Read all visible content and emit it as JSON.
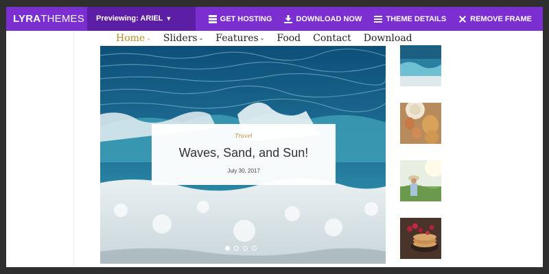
{
  "topbar": {
    "brand_bold": "LYRA",
    "brand_light": "THEMES",
    "preview_label": "Previewing: ARIEL",
    "actions": [
      {
        "label": "GET HOSTING",
        "icon": "server-icon"
      },
      {
        "label": "DOWNLOAD NOW",
        "icon": "download-icon"
      },
      {
        "label": "THEME DETAILS",
        "icon": "list-icon"
      },
      {
        "label": "REMOVE FRAME",
        "icon": "close-icon"
      }
    ]
  },
  "nav": {
    "items": [
      {
        "label": "Home",
        "has_dropdown": true,
        "active": true
      },
      {
        "label": "Sliders",
        "has_dropdown": true
      },
      {
        "label": "Features",
        "has_dropdown": true
      },
      {
        "label": "Food",
        "has_dropdown": false
      },
      {
        "label": "Contact",
        "has_dropdown": false
      },
      {
        "label": "Download",
        "has_dropdown": false
      }
    ]
  },
  "hero": {
    "category": "Travel",
    "title": "Waves, Sand, and Sun!",
    "date": "July 30, 2017",
    "slides_count": 4,
    "active_slide": 1
  },
  "thumbnails": [
    {
      "name": "ocean-thumbnail"
    },
    {
      "name": "eggs-waffles-thumbnail"
    },
    {
      "name": "field-person-thumbnail"
    },
    {
      "name": "pancakes-berries-thumbnail"
    }
  ],
  "colors": {
    "topbar": "#7c2fd1",
    "topbar_dark": "#5c1ea5",
    "accent": "#b88a2a",
    "outer_frame": "#2f2f2f"
  }
}
